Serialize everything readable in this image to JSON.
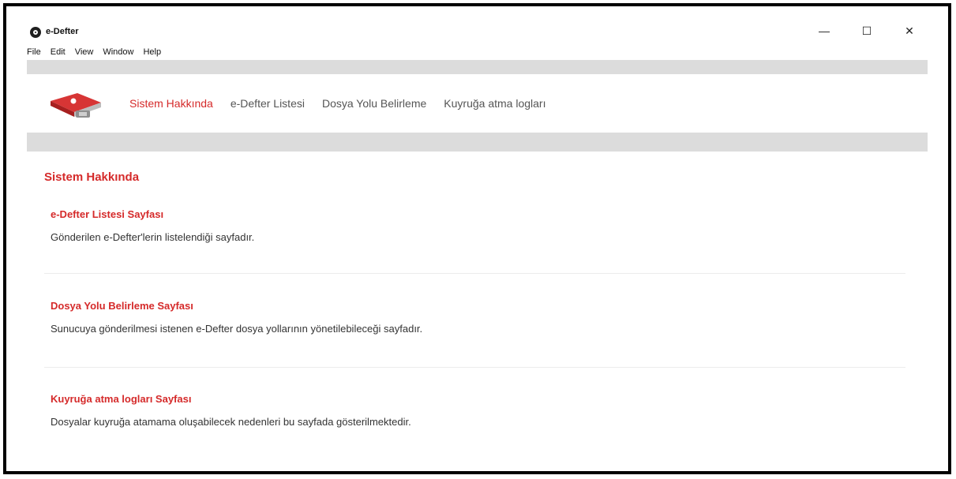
{
  "window": {
    "title": "e-Defter",
    "controls": {
      "minimize": "—",
      "maximize": "☐",
      "close": "✕"
    }
  },
  "menu": [
    "File",
    "Edit",
    "View",
    "Window",
    "Help"
  ],
  "nav": {
    "logo_icon": "book-logo-icon",
    "items": [
      {
        "label": "Sistem Hakkında",
        "active": true
      },
      {
        "label": "e-Defter Listesi",
        "active": false
      },
      {
        "label": "Dosya Yolu Belirleme",
        "active": false
      },
      {
        "label": "Kuyruğa atma logları",
        "active": false
      }
    ]
  },
  "page": {
    "title": "Sistem Hakkında",
    "sections": [
      {
        "heading": "e-Defter Listesi Sayfası",
        "description": "Gönderilen e-Defter'lerin listelendiği sayfadır."
      },
      {
        "heading": "Dosya Yolu Belirleme Sayfası",
        "description": "Sunucuya gönderilmesi istenen e-Defter dosya yollarının yönetilebileceği sayfadır."
      },
      {
        "heading": "Kuyruğa atma logları Sayfası",
        "description": "Dosyalar kuyruğa atamama oluşabilecek nedenleri bu sayfada gösterilmektedir."
      }
    ]
  },
  "colors": {
    "accent": "#d52a2a",
    "text": "#333333",
    "shade": "#dcdcdc"
  }
}
